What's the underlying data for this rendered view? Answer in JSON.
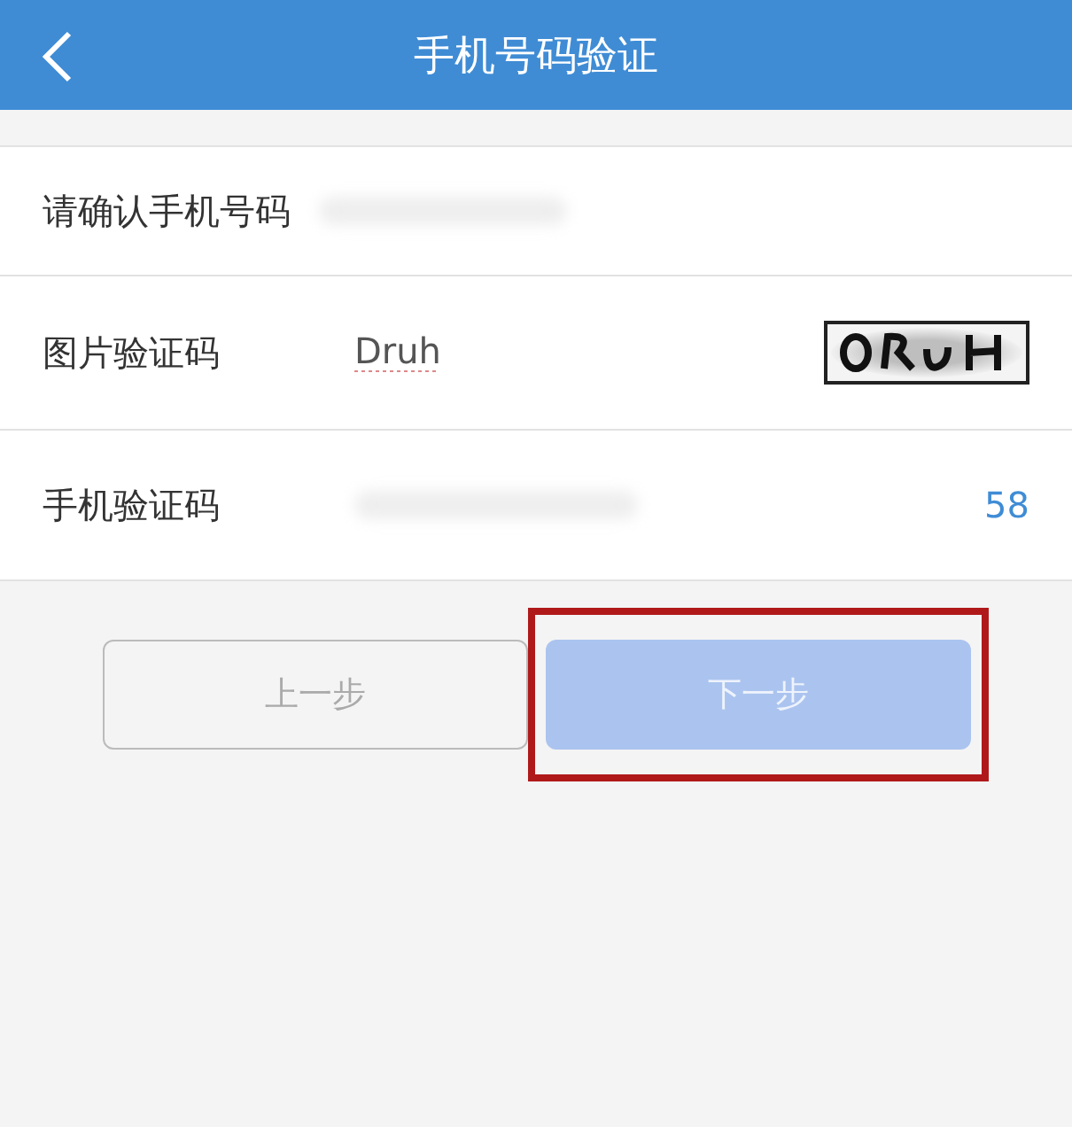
{
  "header": {
    "title": "手机号码验证"
  },
  "rows": [
    {
      "kind": "phone",
      "label": "请确认手机号码",
      "redacted": true
    },
    {
      "kind": "captcha",
      "label": "图片验证码",
      "value": "Druh",
      "spellcheck_flag": true
    },
    {
      "kind": "sms",
      "label": "手机验证码",
      "redacted": true,
      "countdown": "58"
    }
  ],
  "buttons": [
    {
      "label": "上一步",
      "kind": "outline",
      "disabled": false,
      "highlighted": false
    },
    {
      "label": "下一步",
      "kind": "primary",
      "disabled": true,
      "highlighted": true
    }
  ]
}
